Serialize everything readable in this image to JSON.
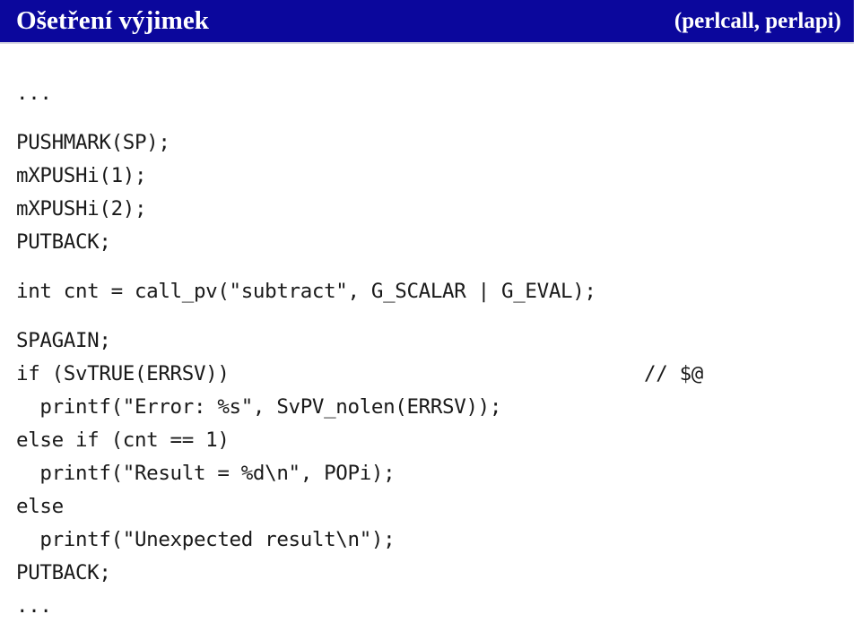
{
  "header": {
    "title": "Ošetření výjimek",
    "subtitle": "(perlcall, perlapi)",
    "background_color": "#0b079c",
    "text_color": "#ffffff"
  },
  "code": {
    "language": "c",
    "lines": [
      {
        "text": "...",
        "indent": 0,
        "gap_before": false,
        "comment": ""
      },
      {
        "text": "PUSHMARK(SP);",
        "indent": 0,
        "gap_before": true,
        "comment": ""
      },
      {
        "text": "mXPUSHi(1);",
        "indent": 0,
        "gap_before": false,
        "comment": ""
      },
      {
        "text": "mXPUSHi(2);",
        "indent": 0,
        "gap_before": false,
        "comment": ""
      },
      {
        "text": "PUTBACK;",
        "indent": 0,
        "gap_before": false,
        "comment": ""
      },
      {
        "text": "int cnt = call_pv(\"subtract\", G_SCALAR | G_EVAL);",
        "indent": 0,
        "gap_before": true,
        "comment": ""
      },
      {
        "text": "SPAGAIN;",
        "indent": 0,
        "gap_before": true,
        "comment": ""
      },
      {
        "text": "if (SvTRUE(ERRSV))",
        "indent": 0,
        "gap_before": false,
        "comment": "// $@"
      },
      {
        "text": "  printf(\"Error: %s\", SvPV_nolen(ERRSV));",
        "indent": 2,
        "gap_before": false,
        "comment": ""
      },
      {
        "text": "else if (cnt == 1)",
        "indent": 0,
        "gap_before": false,
        "comment": ""
      },
      {
        "text": "  printf(\"Result = %d\\n\", POPi);",
        "indent": 2,
        "gap_before": false,
        "comment": ""
      },
      {
        "text": "else",
        "indent": 0,
        "gap_before": false,
        "comment": ""
      },
      {
        "text": "  printf(\"Unexpected result\\n\");",
        "indent": 2,
        "gap_before": false,
        "comment": ""
      },
      {
        "text": "PUTBACK;",
        "indent": 0,
        "gap_before": false,
        "comment": ""
      },
      {
        "text": "...",
        "indent": 0,
        "gap_before": false,
        "comment": ""
      }
    ]
  }
}
